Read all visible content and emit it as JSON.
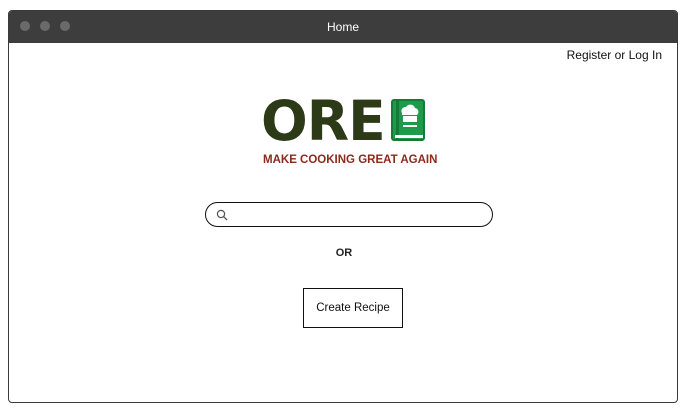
{
  "window": {
    "title": "Home"
  },
  "header": {
    "auth_link": "Register or Log In"
  },
  "logo": {
    "wordmark": "ORE",
    "tagline": "MAKE COOKING GREAT AGAIN"
  },
  "colors": {
    "brand_dark": "#2d3a17",
    "brand_green": "#1f9a4a",
    "tagline_red": "#8c2a1d",
    "titlebar": "#3d3d3d"
  },
  "search": {
    "value": "",
    "placeholder": "",
    "icon": "search-icon"
  },
  "main": {
    "or_label": "OR",
    "create_button": "Create Recipe"
  }
}
